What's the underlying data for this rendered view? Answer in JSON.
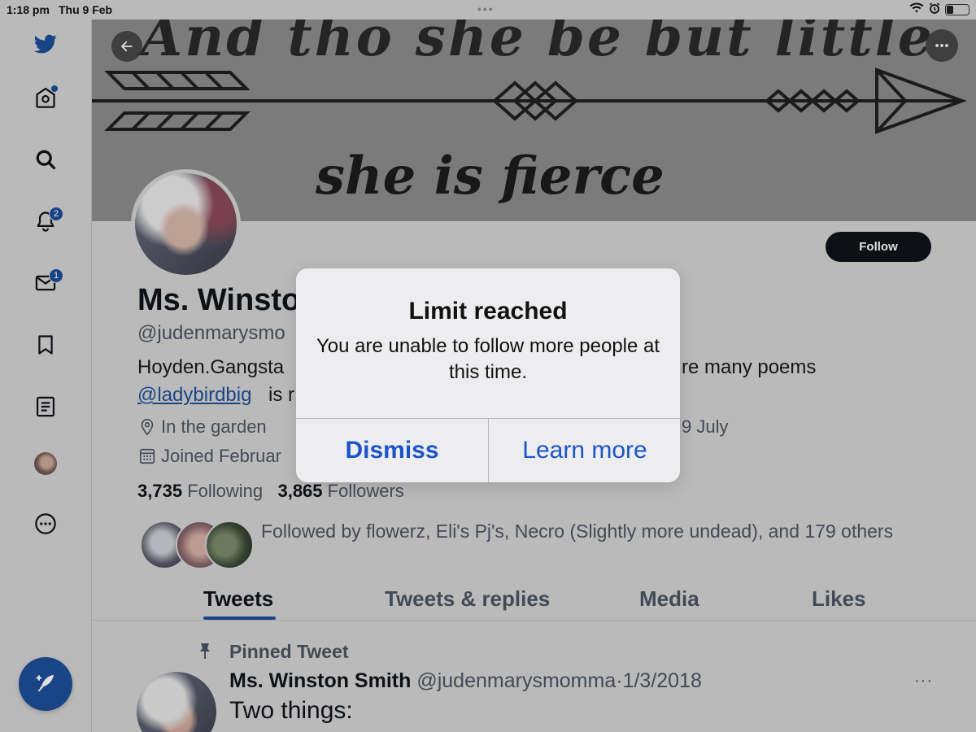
{
  "status_bar": {
    "time": "1:18 pm",
    "date": "Thu 9 Feb",
    "dots": "•••"
  },
  "sidebar": {
    "items": [
      {
        "name": "twitter-logo",
        "icon": "twitter-bird-icon"
      },
      {
        "name": "home",
        "icon": "home-icon",
        "dot": true
      },
      {
        "name": "explore",
        "icon": "search-icon"
      },
      {
        "name": "notifications",
        "icon": "bell-icon",
        "badge": "2"
      },
      {
        "name": "messages",
        "icon": "mail-icon",
        "badge": "1"
      },
      {
        "name": "bookmarks",
        "icon": "bookmark-icon"
      },
      {
        "name": "lists",
        "icon": "list-icon"
      },
      {
        "name": "profile",
        "icon": "avatar"
      },
      {
        "name": "more",
        "icon": "more-circle-icon"
      }
    ],
    "compose_icon": "compose-feather-icon"
  },
  "banner": {
    "line1": "And tho she be but little",
    "line2": "she is fierce"
  },
  "profile": {
    "display_name": "Ms. Winsto",
    "handle": "@judenmarysmo",
    "bio_line1_start": "Hoyden.Gangsta",
    "bio_line1_end": "re many poems",
    "bio_mention": "@ladybirdbig",
    "bio_line2_end": "is r",
    "location": "In the garden",
    "birthday_fragment": "9 July",
    "joined": "Joined Februar",
    "following_count": "3,735",
    "following_label": "Following",
    "followers_count": "3,865",
    "followers_label": "Followers",
    "followed_by": "Followed by flowerz, Eli's Pj's, Necro (Slightly more undead), and 179 others",
    "follow_button": "Follow"
  },
  "tabs": [
    {
      "label": "Tweets",
      "active": true
    },
    {
      "label": "Tweets & replies",
      "active": false
    },
    {
      "label": "Media",
      "active": false
    },
    {
      "label": "Likes",
      "active": false
    }
  ],
  "pinned_tweet": {
    "label": "Pinned Tweet",
    "author_name": "Ms. Winston Smith",
    "author_handle": "@judenmarysmomma",
    "separator": "·",
    "date": "1/3/2018",
    "text": "Two things:",
    "more": "···"
  },
  "dialog": {
    "title": "Limit reached",
    "message": "You are unable to follow more people at this time.",
    "dismiss_label": "Dismiss",
    "learn_more_label": "Learn more"
  },
  "colors": {
    "accent": "#1d4f9a",
    "link": "#1b55c9",
    "text_primary": "#0f1419",
    "text_secondary": "#4d5560"
  }
}
